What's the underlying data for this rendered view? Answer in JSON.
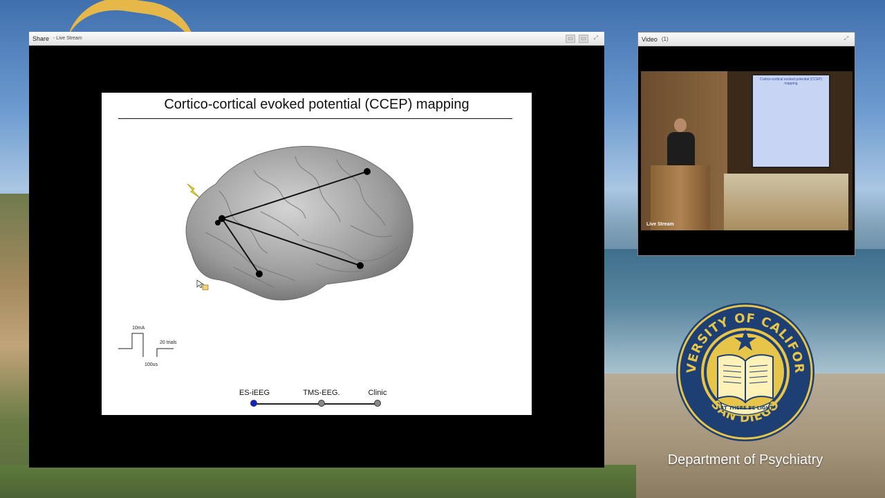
{
  "share": {
    "title": "Share",
    "subtitle": "- Live Stream"
  },
  "slide": {
    "title": "Cortico-cortical evoked potential (CCEP) mapping",
    "pulse": {
      "amplitude_label": "10mA",
      "trials_label": "20 trials",
      "duration_label": "100us"
    },
    "timeline": [
      {
        "label": "ES-iEEG",
        "color": "#1020d0"
      },
      {
        "label": "TMS-EEG.",
        "color": "#888888"
      },
      {
        "label": "Clinic",
        "color": "#888888"
      }
    ]
  },
  "video": {
    "title": "Video",
    "count": "(1)",
    "screen_title": "Cortico-cortical evoked potential (CCEP) mapping",
    "live_label": "Live Stream"
  },
  "seal": {
    "top_text": "UNIVERSITY OF CALIFORNIA",
    "bottom_text": "SAN DIEGO",
    "motto": "LET THERE BE LIGHT",
    "color": "#e7c548"
  },
  "department": "Department of Psychiatry"
}
